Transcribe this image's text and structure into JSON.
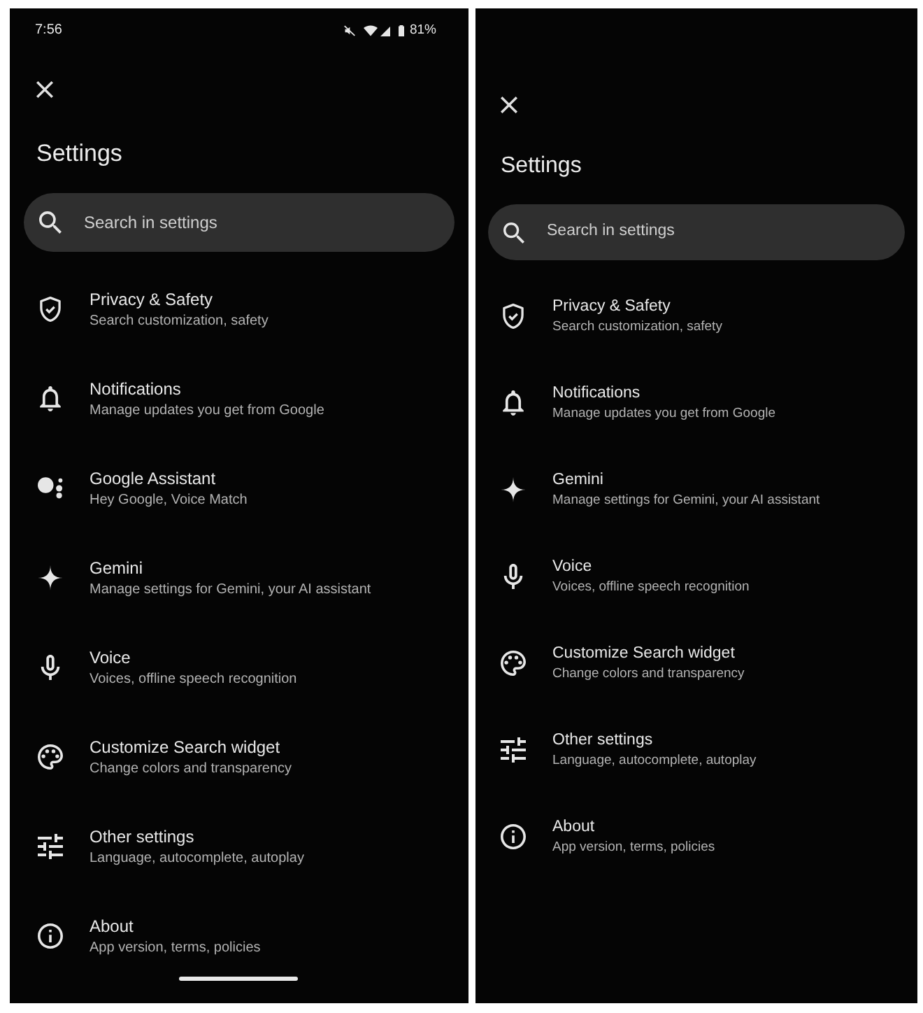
{
  "screens": [
    {
      "status_bar": {
        "time": "7:56",
        "battery": "81%"
      },
      "title": "Settings",
      "search": {
        "placeholder": "Search in settings"
      },
      "items": [
        {
          "kind": "privacy",
          "title": "Privacy & Safety",
          "subtitle": "Search customization, safety"
        },
        {
          "kind": "notifications",
          "title": "Notifications",
          "subtitle": "Manage updates you get from Google"
        },
        {
          "kind": "assistant",
          "title": "Google Assistant",
          "subtitle": "Hey Google, Voice Match"
        },
        {
          "kind": "gemini",
          "title": "Gemini",
          "subtitle": "Manage settings for Gemini, your AI assistant"
        },
        {
          "kind": "voice",
          "title": "Voice",
          "subtitle": "Voices, offline speech recognition"
        },
        {
          "kind": "widget",
          "title": "Customize Search widget",
          "subtitle": "Change colors and transparency"
        },
        {
          "kind": "other",
          "title": "Other settings",
          "subtitle": "Language, autocomplete, autoplay"
        },
        {
          "kind": "about",
          "title": "About",
          "subtitle": "App version, terms, policies"
        }
      ],
      "navigation_handle": true
    },
    {
      "title": "Settings",
      "search": {
        "placeholder": "Search in settings"
      },
      "items": [
        {
          "kind": "privacy",
          "title": "Privacy & Safety",
          "subtitle": "Search customization, safety"
        },
        {
          "kind": "notifications",
          "title": "Notifications",
          "subtitle": "Manage updates you get from Google"
        },
        {
          "kind": "gemini",
          "title": "Gemini",
          "subtitle": "Manage settings for Gemini, your AI assistant"
        },
        {
          "kind": "voice",
          "title": "Voice",
          "subtitle": "Voices, offline speech recognition"
        },
        {
          "kind": "widget",
          "title": "Customize Search widget",
          "subtitle": "Change colors and transparency"
        },
        {
          "kind": "other",
          "title": "Other settings",
          "subtitle": "Language, autocomplete, autoplay"
        },
        {
          "kind": "about",
          "title": "About",
          "subtitle": "App version, terms, policies"
        }
      ]
    }
  ]
}
